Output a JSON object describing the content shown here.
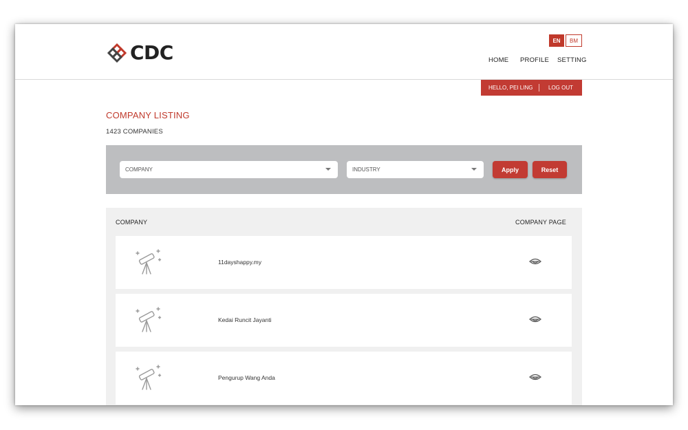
{
  "brand": {
    "logo_text": "CDC",
    "accent_color": "#c23b33"
  },
  "language": {
    "options": [
      "EN",
      "BM"
    ],
    "selected": "EN"
  },
  "nav": {
    "home": "HOME",
    "profile": "PROFILE",
    "setting": "SETTING"
  },
  "user": {
    "greeting": "HELLO, PEI LING",
    "logout": "LOG OUT"
  },
  "page": {
    "title": "COMPANY LISTING",
    "count": "1423 COMPANIES"
  },
  "filters": {
    "company_placeholder": "COMPANY",
    "industry_placeholder": "INDUSTRY",
    "apply_label": "Apply",
    "reset_label": "Reset"
  },
  "table": {
    "columns": {
      "company": "COMPANY",
      "company_page": "COMPANY PAGE"
    },
    "rows": [
      {
        "name": "11dayshappy.my",
        "thumbnail_icon": "telescope-icon",
        "action_icon": "eye-icon"
      },
      {
        "name": "Kedai Runcit Jayanti",
        "thumbnail_icon": "telescope-icon",
        "action_icon": "eye-icon"
      },
      {
        "name": "Pengurup Wang Anda",
        "thumbnail_icon": "telescope-icon",
        "action_icon": "eye-icon"
      }
    ]
  }
}
